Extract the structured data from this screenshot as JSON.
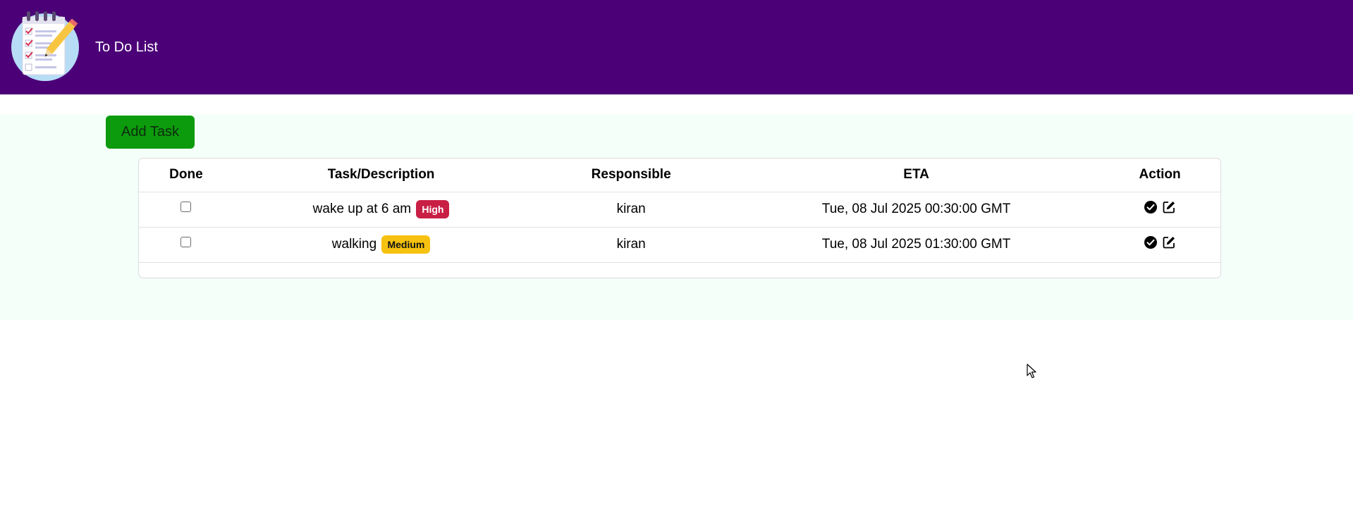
{
  "navbar": {
    "brand": "To Do List",
    "logo_icon": "notepad-checklist-pencil-icon",
    "background": "#4b0077"
  },
  "main": {
    "background": "#f5fffa",
    "add_task_label": "Add Task"
  },
  "table": {
    "headers": [
      "Done",
      "Task/Description",
      "Responsible",
      "ETA",
      "Action"
    ],
    "rows": [
      {
        "done": false,
        "task": "wake up at 6 am",
        "priority": "High",
        "priority_color": "#c91f45",
        "responsible": "kiran",
        "eta": "Tue, 08 Jul 2025 00:30:00 GMT"
      },
      {
        "done": false,
        "task": "walking",
        "priority": "Medium",
        "priority_color": "#f6c20f",
        "responsible": "kiran",
        "eta": "Tue, 08 Jul 2025 01:30:00 GMT"
      }
    ],
    "action_icons": [
      "check-circle-icon",
      "edit-icon"
    ]
  }
}
